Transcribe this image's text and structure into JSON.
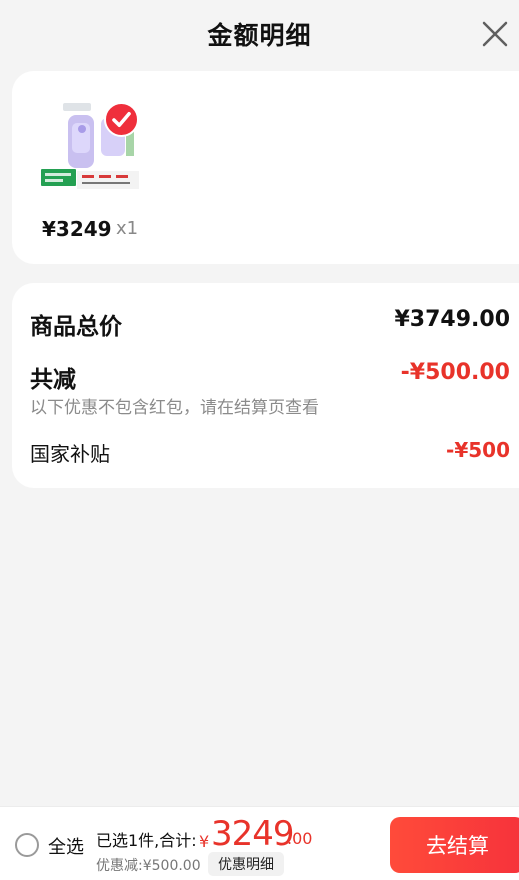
{
  "header": {
    "title": "金额明细"
  },
  "item": {
    "price": "¥3249",
    "quantity": "x1"
  },
  "summary": {
    "total_label": "商品总价",
    "total_value": "¥3749.00",
    "reduction_label": "共减",
    "reduction_value": "-¥500.00",
    "note": "以下优惠不包含红包，请在结算页查看",
    "subsidy_label": "国家补贴",
    "subsidy_value": "-¥500"
  },
  "bottom_bar": {
    "select_all": "全选",
    "selected_total": "已选1件,合计:",
    "currency": "¥",
    "total_int": "3249",
    "total_decimal": ".00",
    "discount": "优惠减:¥500.00",
    "detail_button": "优惠明细",
    "checkout_button": "去结算"
  },
  "colors": {
    "accent": "#e8332a",
    "checkout_gradient": "#ff4b3a"
  },
  "icons": {
    "close": "close-icon",
    "selected": "check-icon",
    "radio": "radio-icon"
  }
}
